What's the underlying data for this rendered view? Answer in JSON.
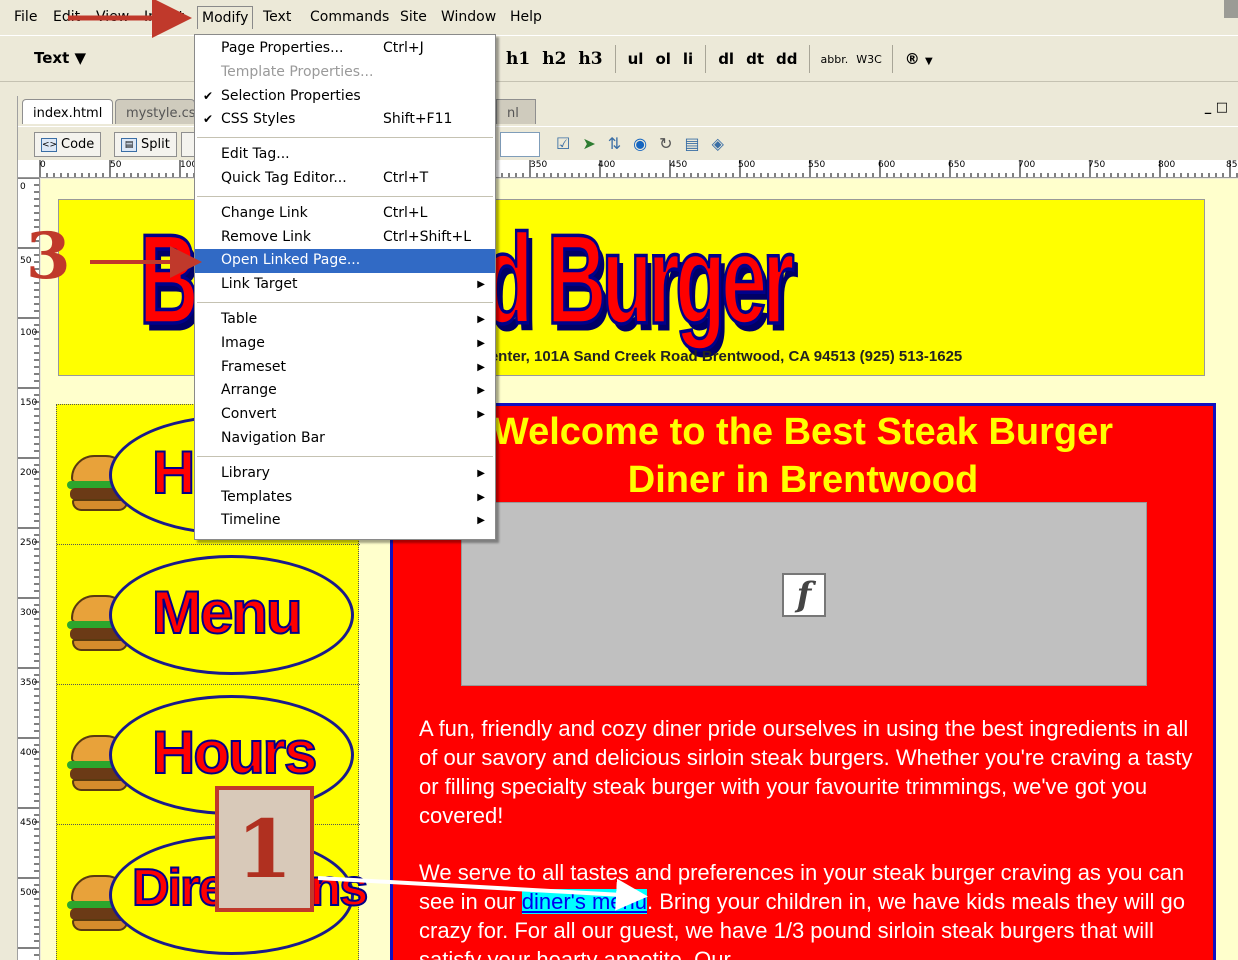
{
  "menubar": {
    "items": [
      "File",
      "Edit",
      "View",
      "Insert",
      "Modify",
      "Text",
      "Commands",
      "Site",
      "Window",
      "Help"
    ]
  },
  "insert_bar": {
    "category_label": "Text",
    "tags": [
      "h1",
      "h2",
      "h3",
      "ul",
      "ol",
      "li",
      "dl",
      "dt",
      "dd",
      "abbr.",
      "W3C",
      "®"
    ]
  },
  "doc_tabs": [
    "index.html",
    "mystyle.css"
  ],
  "doc_tab_partial": "nl",
  "doc_toolbar": {
    "code_label": "Code",
    "split_label": "Split"
  },
  "ruler_top": [
    "0",
    "50",
    "100",
    "350",
    "400",
    "450",
    "500",
    "550",
    "600",
    "650",
    "700",
    "750",
    "800",
    "85"
  ],
  "ruler_left": [
    "0",
    "50",
    "100",
    "150",
    "200",
    "250",
    "300",
    "350",
    "400",
    "450",
    "500"
  ],
  "modify_menu": {
    "items": [
      {
        "label": "Page Properties...",
        "shortcut": "Ctrl+J"
      },
      {
        "label": "Template Properties...",
        "disabled": true
      },
      {
        "label": "Selection Properties",
        "checked": true
      },
      {
        "label": "CSS Styles",
        "shortcut": "Shift+F11",
        "checked": true
      },
      {
        "sep": true
      },
      {
        "label": "Edit Tag..."
      },
      {
        "label": "Quick Tag Editor...",
        "shortcut": "Ctrl+T"
      },
      {
        "sep": true
      },
      {
        "label": "Change Link",
        "shortcut": "Ctrl+L"
      },
      {
        "label": "Remove Link",
        "shortcut": "Ctrl+Shift+L"
      },
      {
        "label": "Open Linked Page...",
        "selected": true
      },
      {
        "label": "Link Target",
        "submenu": true
      },
      {
        "sep": true
      },
      {
        "label": "Table",
        "submenu": true
      },
      {
        "label": "Image",
        "submenu": true
      },
      {
        "label": "Frameset",
        "submenu": true
      },
      {
        "label": "Arrange",
        "submenu": true
      },
      {
        "label": "Convert",
        "submenu": true
      },
      {
        "label": "Navigation Bar"
      },
      {
        "sep": true
      },
      {
        "label": "Library",
        "submenu": true
      },
      {
        "label": "Templates",
        "submenu": true
      },
      {
        "label": "Timeline",
        "submenu": true
      }
    ]
  },
  "page": {
    "logo_text": "Brentwood Burger",
    "address": "Center, 101A Sand Creek Road Brentwood, CA 94513 (925) 513-1625",
    "nav_labels": [
      "Home",
      "Menu",
      "Hours",
      "Directions"
    ],
    "welcome_line1": "Welcome to the Best Steak Burger",
    "welcome_line2": "Diner in Brentwood",
    "flash_icon": "f",
    "para1": "A fun, friendly and cozy diner pride ourselves in using the best ingredients in all of our savory and delicious sirloin steak burgers. Whether you're craving a tasty or filling specialty steak burger with your favourite trimmings, we've got you covered!",
    "para2_before": "We serve to all tastes and preferences in your steak burger craving as you can see in our ",
    "para2_link": "diner's menu",
    "para2_after": ". Bring your children in, we have kids meals they will go crazy for. For all our guest, we have 1/3 pound sirloin steak burgers that will satisfy your hearty appetite. Our"
  },
  "annotations": {
    "step1": "1",
    "step3": "3"
  },
  "colors": {
    "annotation": "#c0392b",
    "menu_highlight": "#316ac5"
  }
}
